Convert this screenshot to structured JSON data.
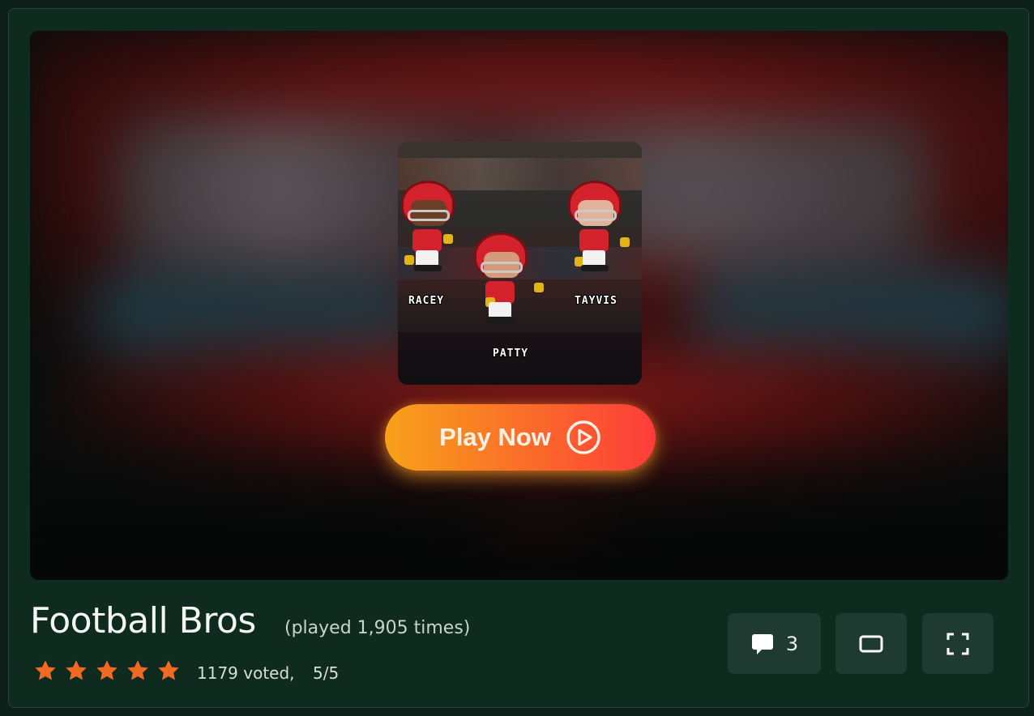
{
  "game": {
    "title": "Football Bros",
    "played_text": "(played 1,905 times)",
    "votes_text": "1179 voted,",
    "score_text": "5/5",
    "rating_stars": 5
  },
  "thumbnail": {
    "players": [
      "RACEY",
      "PATTY",
      "TAYVIS"
    ]
  },
  "play_button": {
    "label": "Play Now",
    "icon": "play-circle-icon"
  },
  "toolbar": {
    "comments_count": "3",
    "comments_icon": "comment-bubble-icon",
    "theater_icon": "theater-mode-icon",
    "fullscreen_icon": "fullscreen-icon"
  },
  "colors": {
    "background": "#0f2a1f",
    "star": "#f26a22",
    "button_start": "#f7a11a",
    "button_end": "#fd3c3a",
    "tool_button": "#1f3b31"
  }
}
